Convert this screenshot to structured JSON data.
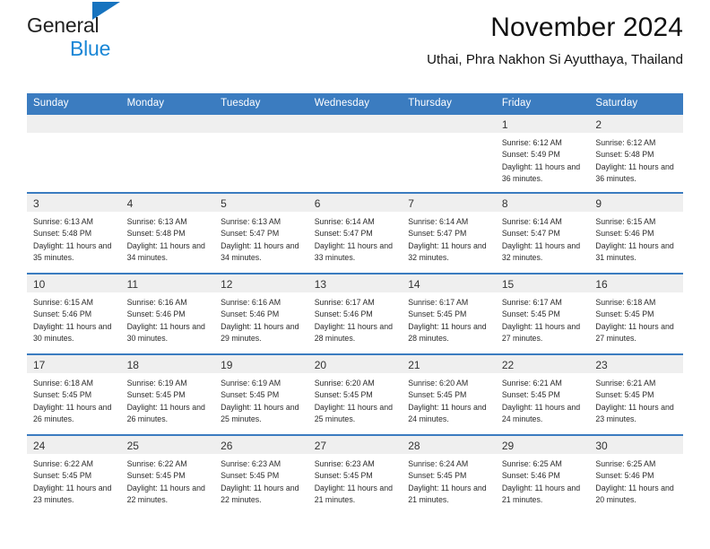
{
  "brand": {
    "name_part1": "General",
    "name_part2": "Blue",
    "triangle_icon": "triangle-icon"
  },
  "header": {
    "title": "November 2024",
    "subtitle": "Uthai, Phra Nakhon Si Ayutthaya, Thailand"
  },
  "colors": {
    "header_blue": "#3B7CC0",
    "logo_blue": "#1886d6",
    "daynum_bg": "#EFEFEF"
  },
  "weekdays": [
    "Sunday",
    "Monday",
    "Tuesday",
    "Wednesday",
    "Thursday",
    "Friday",
    "Saturday"
  ],
  "labels": {
    "sunrise": "Sunrise:",
    "sunset": "Sunset:",
    "daylight": "Daylight:"
  },
  "weeks": [
    [
      {
        "day": "",
        "empty": true
      },
      {
        "day": "",
        "empty": true
      },
      {
        "day": "",
        "empty": true
      },
      {
        "day": "",
        "empty": true
      },
      {
        "day": "",
        "empty": true
      },
      {
        "day": "1",
        "sunrise": "Sunrise: 6:12 AM",
        "sunset": "Sunset: 5:49 PM",
        "daylight": "Daylight: 11 hours and 36 minutes."
      },
      {
        "day": "2",
        "sunrise": "Sunrise: 6:12 AM",
        "sunset": "Sunset: 5:48 PM",
        "daylight": "Daylight: 11 hours and 36 minutes."
      }
    ],
    [
      {
        "day": "3",
        "sunrise": "Sunrise: 6:13 AM",
        "sunset": "Sunset: 5:48 PM",
        "daylight": "Daylight: 11 hours and 35 minutes."
      },
      {
        "day": "4",
        "sunrise": "Sunrise: 6:13 AM",
        "sunset": "Sunset: 5:48 PM",
        "daylight": "Daylight: 11 hours and 34 minutes."
      },
      {
        "day": "5",
        "sunrise": "Sunrise: 6:13 AM",
        "sunset": "Sunset: 5:47 PM",
        "daylight": "Daylight: 11 hours and 34 minutes."
      },
      {
        "day": "6",
        "sunrise": "Sunrise: 6:14 AM",
        "sunset": "Sunset: 5:47 PM",
        "daylight": "Daylight: 11 hours and 33 minutes."
      },
      {
        "day": "7",
        "sunrise": "Sunrise: 6:14 AM",
        "sunset": "Sunset: 5:47 PM",
        "daylight": "Daylight: 11 hours and 32 minutes."
      },
      {
        "day": "8",
        "sunrise": "Sunrise: 6:14 AM",
        "sunset": "Sunset: 5:47 PM",
        "daylight": "Daylight: 11 hours and 32 minutes."
      },
      {
        "day": "9",
        "sunrise": "Sunrise: 6:15 AM",
        "sunset": "Sunset: 5:46 PM",
        "daylight": "Daylight: 11 hours and 31 minutes."
      }
    ],
    [
      {
        "day": "10",
        "sunrise": "Sunrise: 6:15 AM",
        "sunset": "Sunset: 5:46 PM",
        "daylight": "Daylight: 11 hours and 30 minutes."
      },
      {
        "day": "11",
        "sunrise": "Sunrise: 6:16 AM",
        "sunset": "Sunset: 5:46 PM",
        "daylight": "Daylight: 11 hours and 30 minutes."
      },
      {
        "day": "12",
        "sunrise": "Sunrise: 6:16 AM",
        "sunset": "Sunset: 5:46 PM",
        "daylight": "Daylight: 11 hours and 29 minutes."
      },
      {
        "day": "13",
        "sunrise": "Sunrise: 6:17 AM",
        "sunset": "Sunset: 5:46 PM",
        "daylight": "Daylight: 11 hours and 28 minutes."
      },
      {
        "day": "14",
        "sunrise": "Sunrise: 6:17 AM",
        "sunset": "Sunset: 5:45 PM",
        "daylight": "Daylight: 11 hours and 28 minutes."
      },
      {
        "day": "15",
        "sunrise": "Sunrise: 6:17 AM",
        "sunset": "Sunset: 5:45 PM",
        "daylight": "Daylight: 11 hours and 27 minutes."
      },
      {
        "day": "16",
        "sunrise": "Sunrise: 6:18 AM",
        "sunset": "Sunset: 5:45 PM",
        "daylight": "Daylight: 11 hours and 27 minutes."
      }
    ],
    [
      {
        "day": "17",
        "sunrise": "Sunrise: 6:18 AM",
        "sunset": "Sunset: 5:45 PM",
        "daylight": "Daylight: 11 hours and 26 minutes."
      },
      {
        "day": "18",
        "sunrise": "Sunrise: 6:19 AM",
        "sunset": "Sunset: 5:45 PM",
        "daylight": "Daylight: 11 hours and 26 minutes."
      },
      {
        "day": "19",
        "sunrise": "Sunrise: 6:19 AM",
        "sunset": "Sunset: 5:45 PM",
        "daylight": "Daylight: 11 hours and 25 minutes."
      },
      {
        "day": "20",
        "sunrise": "Sunrise: 6:20 AM",
        "sunset": "Sunset: 5:45 PM",
        "daylight": "Daylight: 11 hours and 25 minutes."
      },
      {
        "day": "21",
        "sunrise": "Sunrise: 6:20 AM",
        "sunset": "Sunset: 5:45 PM",
        "daylight": "Daylight: 11 hours and 24 minutes."
      },
      {
        "day": "22",
        "sunrise": "Sunrise: 6:21 AM",
        "sunset": "Sunset: 5:45 PM",
        "daylight": "Daylight: 11 hours and 24 minutes."
      },
      {
        "day": "23",
        "sunrise": "Sunrise: 6:21 AM",
        "sunset": "Sunset: 5:45 PM",
        "daylight": "Daylight: 11 hours and 23 minutes."
      }
    ],
    [
      {
        "day": "24",
        "sunrise": "Sunrise: 6:22 AM",
        "sunset": "Sunset: 5:45 PM",
        "daylight": "Daylight: 11 hours and 23 minutes."
      },
      {
        "day": "25",
        "sunrise": "Sunrise: 6:22 AM",
        "sunset": "Sunset: 5:45 PM",
        "daylight": "Daylight: 11 hours and 22 minutes."
      },
      {
        "day": "26",
        "sunrise": "Sunrise: 6:23 AM",
        "sunset": "Sunset: 5:45 PM",
        "daylight": "Daylight: 11 hours and 22 minutes."
      },
      {
        "day": "27",
        "sunrise": "Sunrise: 6:23 AM",
        "sunset": "Sunset: 5:45 PM",
        "daylight": "Daylight: 11 hours and 21 minutes."
      },
      {
        "day": "28",
        "sunrise": "Sunrise: 6:24 AM",
        "sunset": "Sunset: 5:45 PM",
        "daylight": "Daylight: 11 hours and 21 minutes."
      },
      {
        "day": "29",
        "sunrise": "Sunrise: 6:25 AM",
        "sunset": "Sunset: 5:46 PM",
        "daylight": "Daylight: 11 hours and 21 minutes."
      },
      {
        "day": "30",
        "sunrise": "Sunrise: 6:25 AM",
        "sunset": "Sunset: 5:46 PM",
        "daylight": "Daylight: 11 hours and 20 minutes."
      }
    ]
  ]
}
